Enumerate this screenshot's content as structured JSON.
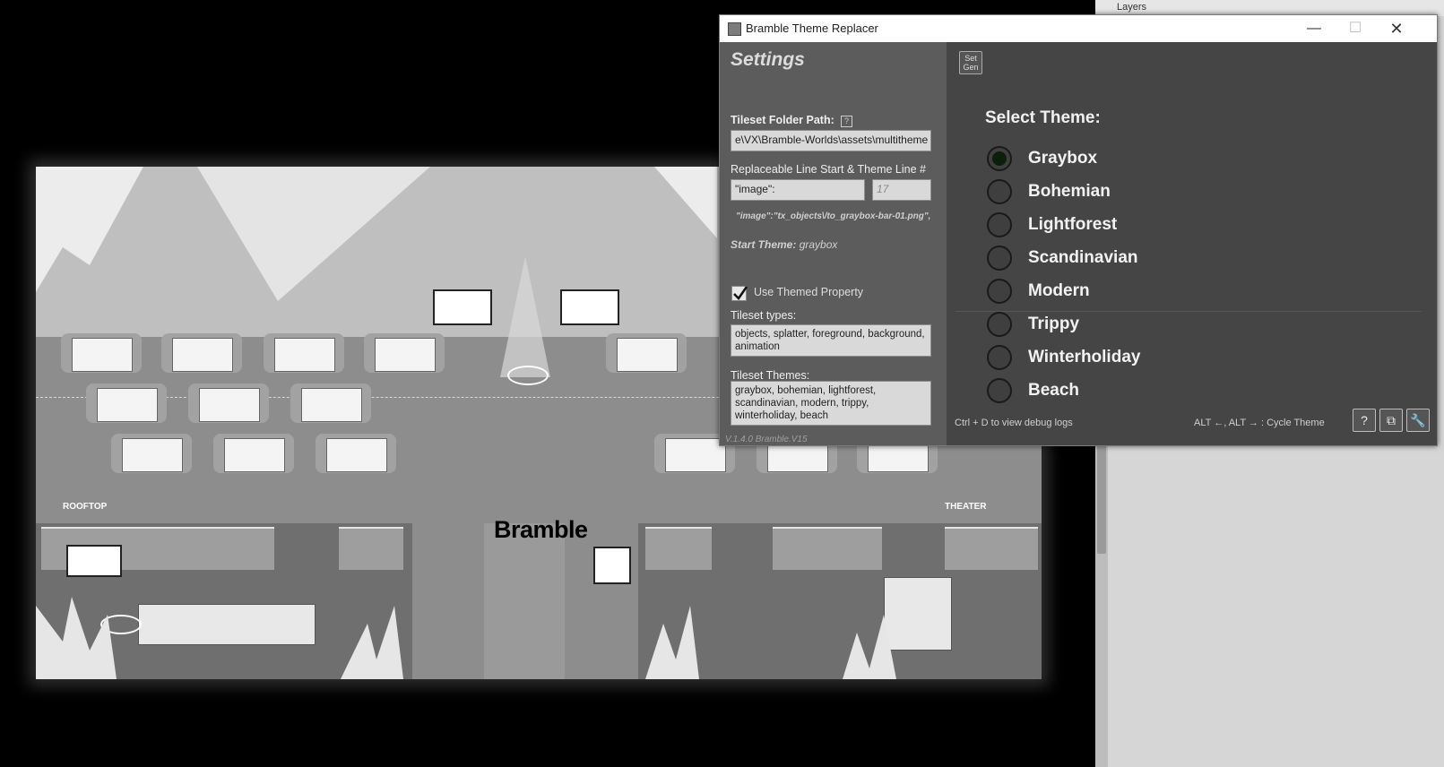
{
  "background_panel": {
    "header": "Layers"
  },
  "map": {
    "brand": "Bramble",
    "labels": {
      "rooftop": "ROOFTOP",
      "theater": "THEATER"
    }
  },
  "window": {
    "title": "Bramble Theme Replacer",
    "controls": {
      "minimize": "—",
      "maximize": "☐",
      "close": "✕"
    }
  },
  "settings": {
    "heading": "Settings",
    "tileset_folder_label": "Tileset Folder Path:",
    "tileset_folder_help": "?",
    "tileset_folder_value": "e\\VX\\Bramble-Worlds\\assets\\multitheme",
    "replaceable_label": "Replaceable Line Start & Theme Line #",
    "replaceable_start_value": "\"image\":",
    "theme_line_placeholder": "17",
    "example_line": "\"image\":\"tx_objects\\/to_graybox-bar-01.png\",",
    "start_theme_label": "Start Theme:",
    "start_theme_value": "graybox",
    "use_themed_property_label": "Use Themed Property",
    "use_themed_property_checked": true,
    "tileset_types_label": "Tileset types:",
    "tileset_types_value": "objects, splatter, foreground, background, animation",
    "tileset_themes_label": "Tileset Themes:",
    "tileset_themes_value": "graybox, bohemian, lightforest, scandinavian, modern, trippy, winterholiday, beach",
    "version": "V.1.4.0 Bramble.V15"
  },
  "theme_panel": {
    "set_gen": "Set Gen",
    "heading": "Select Theme:",
    "selected": "Graybox",
    "themes": [
      "Graybox",
      "Bohemian",
      "Lightforest",
      "Scandinavian",
      "Modern",
      "Trippy",
      "Winterholiday",
      "Beach"
    ],
    "debug_hint": "Ctrl + D to view debug logs",
    "cycle_hint": "ALT ←, ALT → :  Cycle Theme",
    "buttons": {
      "help": "?",
      "windows": "⧉",
      "tools": "🔧"
    }
  }
}
